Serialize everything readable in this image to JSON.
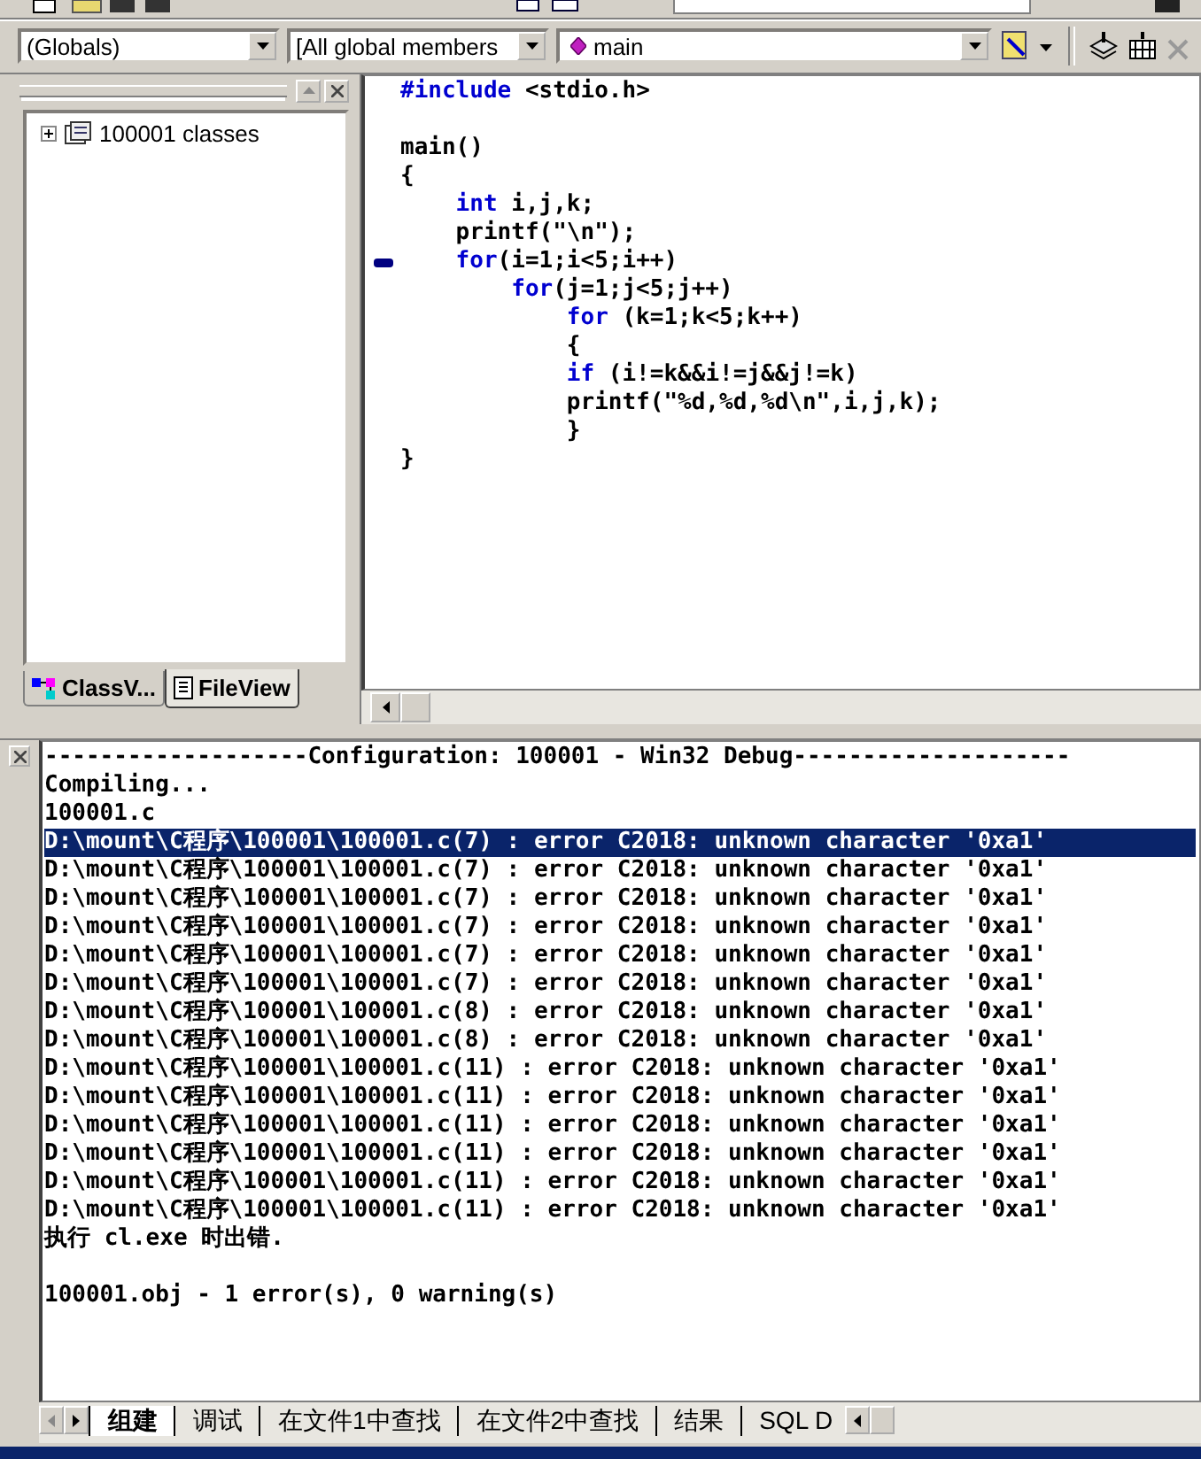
{
  "toolbar": {
    "scope_combo": "(Globals)",
    "members_combo": "[All global members",
    "function_combo": "main"
  },
  "workspace": {
    "tree": [
      {
        "label": "100001 classes",
        "expanded": false
      }
    ],
    "tabs": [
      {
        "label": "ClassV...",
        "kind": "class",
        "selected": false
      },
      {
        "label": "FileView",
        "kind": "file",
        "selected": true
      }
    ]
  },
  "editor": {
    "lines": [
      {
        "marker": false,
        "code": [
          {
            "kind": "keyword",
            "text": "#include"
          },
          {
            "kind": "plain",
            "text": " <stdio.h>"
          }
        ]
      },
      {
        "marker": false
      },
      {
        "marker": false,
        "code": [
          {
            "kind": "plain",
            "text": "main()"
          }
        ]
      },
      {
        "marker": false,
        "code": [
          {
            "kind": "plain",
            "text": "{"
          }
        ]
      },
      {
        "marker": false,
        "code": [
          {
            "kind": "keyword",
            "text": "    int"
          },
          {
            "kind": "plain",
            "text": " i,j,k;"
          }
        ]
      },
      {
        "marker": false,
        "code": [
          {
            "kind": "plain",
            "text": "    printf(\"\\n\");"
          }
        ]
      },
      {
        "marker": true,
        "code": [
          {
            "kind": "keyword",
            "text": "    for"
          },
          {
            "kind": "plain",
            "text": "(i=1;i<5;i++)"
          }
        ]
      },
      {
        "marker": false,
        "code": [
          {
            "kind": "keyword",
            "text": "        for"
          },
          {
            "kind": "plain",
            "text": "(j=1;j<5;j++)"
          }
        ]
      },
      {
        "marker": false,
        "code": [
          {
            "kind": "keyword",
            "text": "            for"
          },
          {
            "kind": "plain",
            "text": " (k=1;k<5;k++)"
          }
        ]
      },
      {
        "marker": false,
        "code": [
          {
            "kind": "plain",
            "text": "            {"
          }
        ]
      },
      {
        "marker": false,
        "code": [
          {
            "kind": "keyword",
            "text": "            if"
          },
          {
            "kind": "plain",
            "text": " (i!=k&&i!=j&&j!=k)"
          }
        ]
      },
      {
        "marker": false,
        "code": [
          {
            "kind": "plain",
            "text": "            printf(\"%d,%d,%d\\n\",i,j,k);"
          }
        ]
      },
      {
        "marker": false,
        "code": [
          {
            "kind": "plain",
            "text": "            }"
          }
        ]
      },
      {
        "marker": false,
        "code": [
          {
            "kind": "plain",
            "text": "}"
          }
        ]
      }
    ]
  },
  "output": {
    "lines": [
      {
        "kind": "text",
        "text": "-------------------Configuration: 100001 - Win32 Debug--------------------",
        "selected": false
      },
      {
        "kind": "text",
        "text": "Compiling...",
        "selected": false
      },
      {
        "kind": "text",
        "text": "100001.c",
        "selected": false
      },
      {
        "kind": "text",
        "text": "D:\\mount\\C程序\\100001\\100001.c(7) : error C2018: unknown character '0xa1'",
        "selected": true
      },
      {
        "kind": "text",
        "text": "D:\\mount\\C程序\\100001\\100001.c(7) : error C2018: unknown character '0xa1'",
        "selected": false
      },
      {
        "kind": "text",
        "text": "D:\\mount\\C程序\\100001\\100001.c(7) : error C2018: unknown character '0xa1'",
        "selected": false
      },
      {
        "kind": "text",
        "text": "D:\\mount\\C程序\\100001\\100001.c(7) : error C2018: unknown character '0xa1'",
        "selected": false
      },
      {
        "kind": "text",
        "text": "D:\\mount\\C程序\\100001\\100001.c(7) : error C2018: unknown character '0xa1'",
        "selected": false
      },
      {
        "kind": "text",
        "text": "D:\\mount\\C程序\\100001\\100001.c(7) : error C2018: unknown character '0xa1'",
        "selected": false
      },
      {
        "kind": "text",
        "text": "D:\\mount\\C程序\\100001\\100001.c(8) : error C2018: unknown character '0xa1'",
        "selected": false
      },
      {
        "kind": "text",
        "text": "D:\\mount\\C程序\\100001\\100001.c(8) : error C2018: unknown character '0xa1'",
        "selected": false
      },
      {
        "kind": "text",
        "text": "D:\\mount\\C程序\\100001\\100001.c(11) : error C2018: unknown character '0xa1'",
        "selected": false
      },
      {
        "kind": "text",
        "text": "D:\\mount\\C程序\\100001\\100001.c(11) : error C2018: unknown character '0xa1'",
        "selected": false
      },
      {
        "kind": "text",
        "text": "D:\\mount\\C程序\\100001\\100001.c(11) : error C2018: unknown character '0xa1'",
        "selected": false
      },
      {
        "kind": "text",
        "text": "D:\\mount\\C程序\\100001\\100001.c(11) : error C2018: unknown character '0xa1'",
        "selected": false
      },
      {
        "kind": "text",
        "text": "D:\\mount\\C程序\\100001\\100001.c(11) : error C2018: unknown character '0xa1'",
        "selected": false
      },
      {
        "kind": "text",
        "text": "D:\\mount\\C程序\\100001\\100001.c(11) : error C2018: unknown character '0xa1'",
        "selected": false
      },
      {
        "kind": "text",
        "text": "执行 cl.exe 时出错.",
        "selected": false
      },
      {
        "kind": "blank",
        "selected": false
      },
      {
        "kind": "text",
        "text": "100001.obj - 1 error(s), 0 warning(s)",
        "selected": false
      }
    ],
    "tabs": [
      {
        "label": "组建",
        "selected": true
      },
      {
        "label": "调试",
        "selected": false
      },
      {
        "label": "在文件1中查找",
        "selected": false
      },
      {
        "label": "在文件2中查找",
        "selected": false
      },
      {
        "label": "结果",
        "selected": false
      },
      {
        "label": "SQL D",
        "selected": false
      }
    ]
  }
}
